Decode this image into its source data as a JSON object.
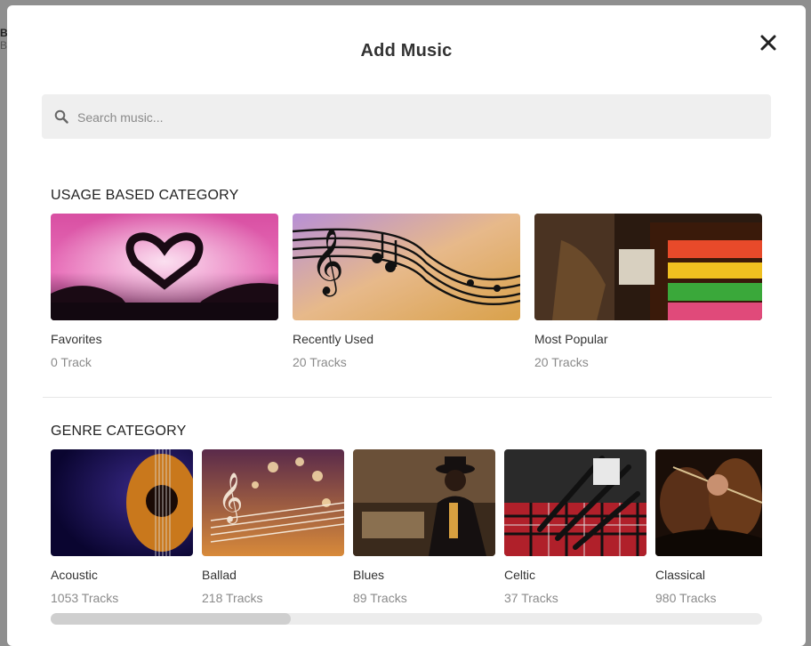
{
  "modal": {
    "title": "Add Music"
  },
  "search": {
    "placeholder": "Search music..."
  },
  "usage": {
    "title": "USAGE BASED CATEGORY",
    "items": [
      {
        "name": "Favorites",
        "count": "0 Track"
      },
      {
        "name": "Recently Used",
        "count": "20 Tracks"
      },
      {
        "name": "Most Popular",
        "count": "20 Tracks"
      }
    ]
  },
  "genre": {
    "title": "GENRE CATEGORY",
    "items": [
      {
        "name": "Acoustic",
        "count": "1053 Tracks"
      },
      {
        "name": "Ballad",
        "count": "218 Tracks"
      },
      {
        "name": "Blues",
        "count": "89 Tracks"
      },
      {
        "name": "Celtic",
        "count": "37 Tracks"
      },
      {
        "name": "Classical",
        "count": "980 Tracks"
      }
    ]
  },
  "icons": {
    "close": "close-icon",
    "search": "search-icon"
  },
  "colors": {
    "overlay": "#8f8f8f",
    "panel": "#ffffff",
    "search_bg": "#efefef",
    "muted_text": "#8a8a8a"
  }
}
